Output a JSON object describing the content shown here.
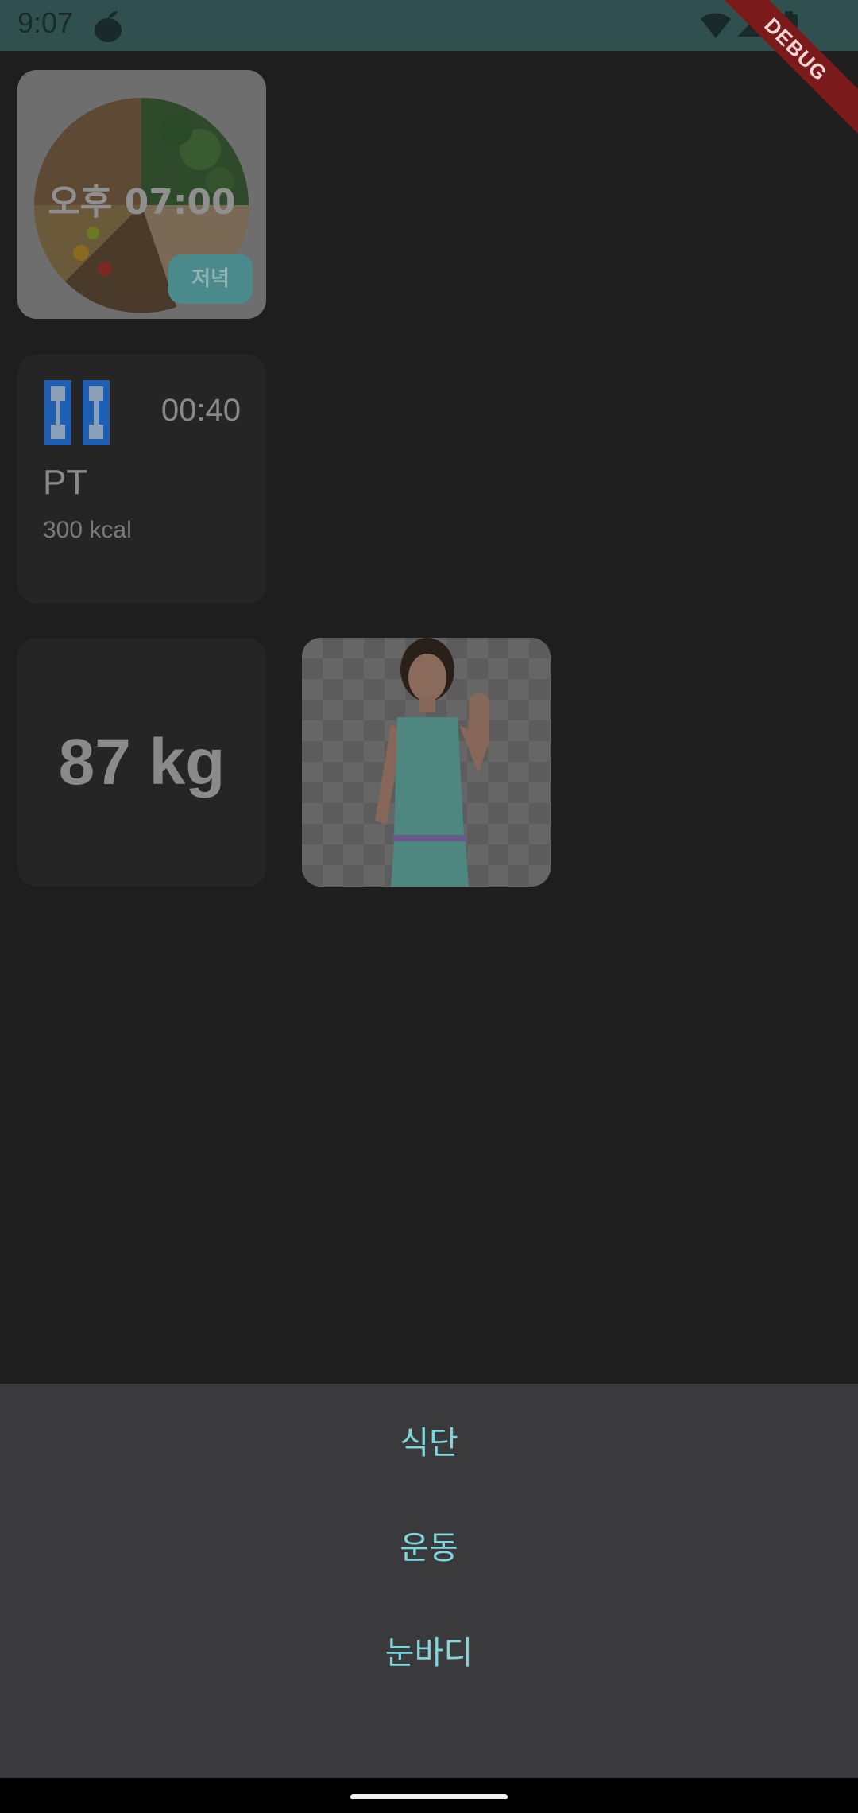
{
  "status_bar": {
    "time": "9:07",
    "icons": [
      "app-notification-icon",
      "wifi-icon",
      "signal-icon",
      "battery-icon"
    ]
  },
  "debug_banner": "DEBUG",
  "meal_card": {
    "time": "오후 07:00",
    "badge": "저녁",
    "image": "salad-bowl-photo"
  },
  "exercise_card": {
    "icon": "dumbbell-icon",
    "duration": "00:40",
    "name": "PT",
    "kcal": "300 kcal"
  },
  "weight_card": {
    "value": "87 kg"
  },
  "photo_card": {
    "image": "woman-thumbs-up-photo"
  },
  "bottom_sheet": {
    "items": [
      "식단",
      "운동",
      "눈바디"
    ]
  },
  "colors": {
    "accent": "#7fd6dd",
    "badge": "#4a8a8c",
    "dumbbell": "#1e5fb4",
    "sheet_bg": "#3a3a3c",
    "debug_ribbon": "#7a1a1a"
  }
}
